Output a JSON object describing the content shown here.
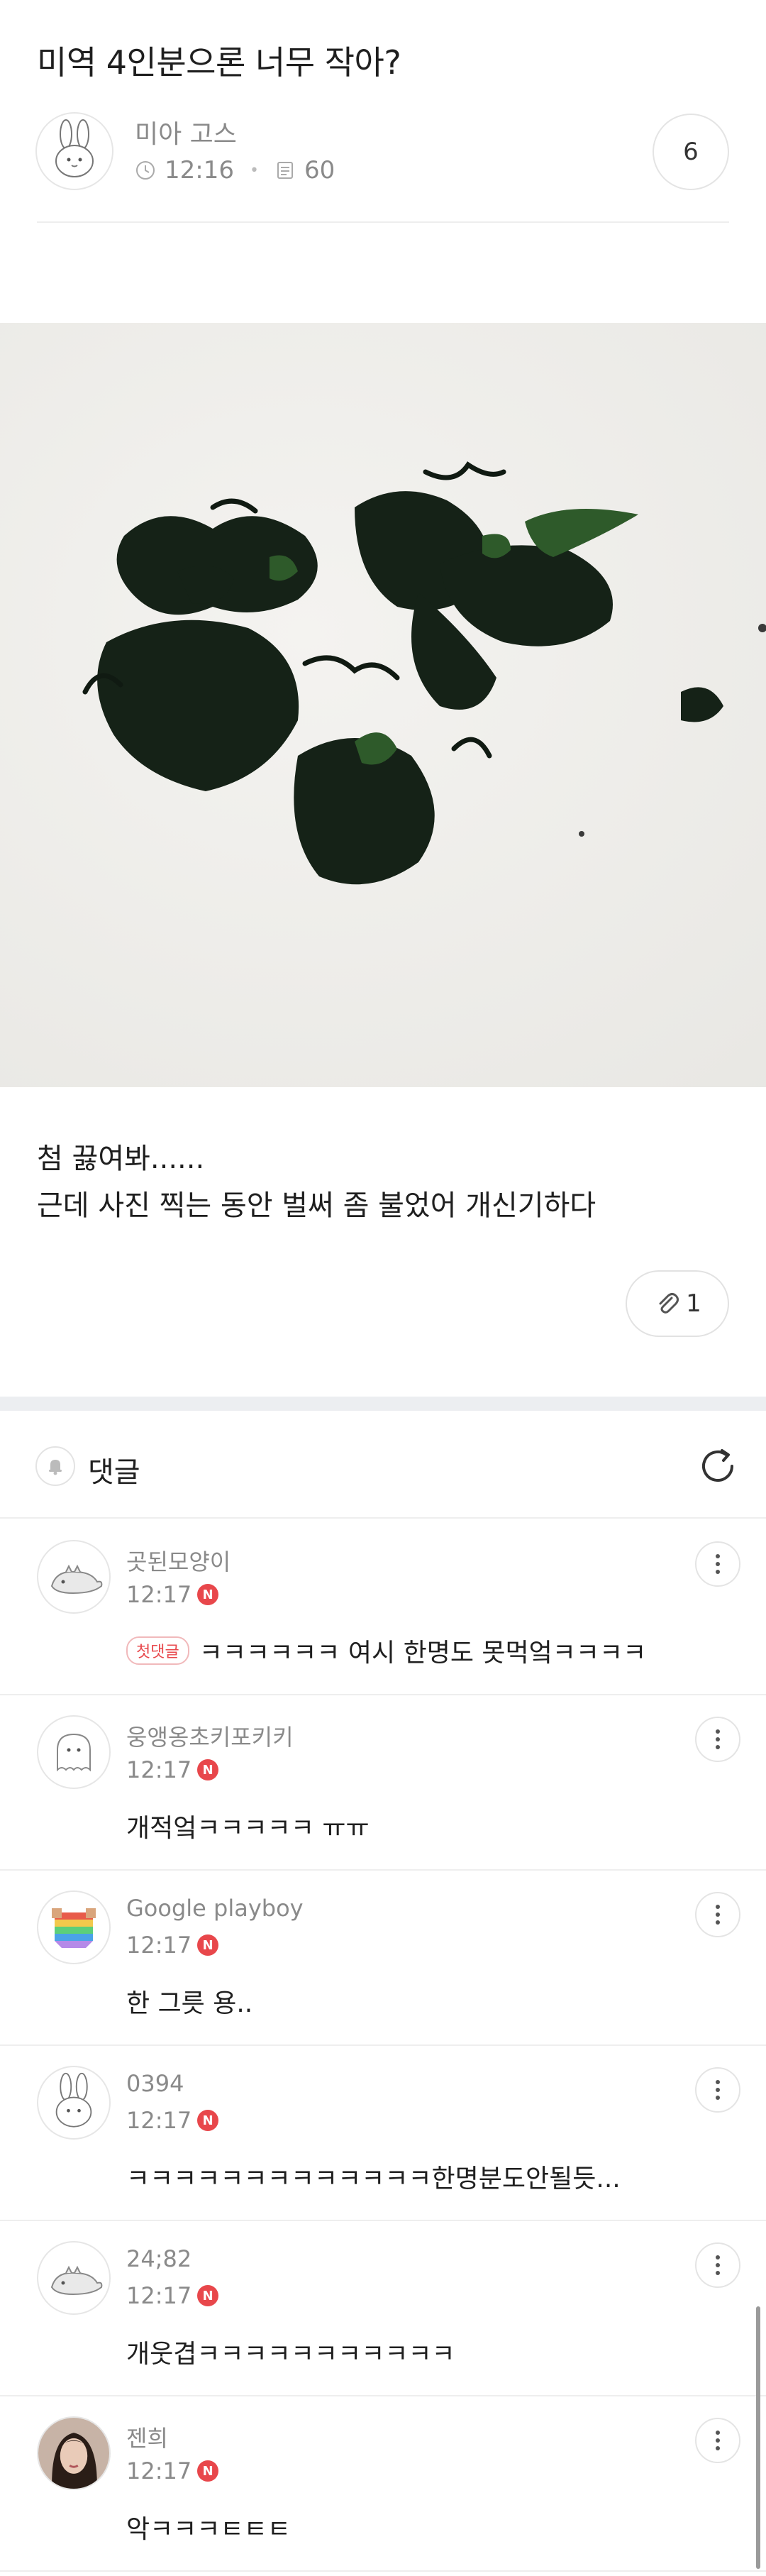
{
  "post": {
    "title": "미역 4인분으론 너무 작아?",
    "author": "미아 고스",
    "time": "12:16",
    "views": "60",
    "comment_count": "6",
    "body_lines": [
      "첨 끓여봐......",
      "근데 사진 찍는 동안 벌써 좀 불었어 개신기하다"
    ],
    "attachments": "1"
  },
  "comments_section": {
    "title": "댓글"
  },
  "comments": [
    {
      "name": "곳된모양이",
      "time": "12:17",
      "badge": "첫댓글",
      "text": "ㅋㅋㅋㅋㅋㅋ 여시 한명도 못먹엌ㅋㅋㅋㅋ",
      "avatar": "dino"
    },
    {
      "name": "웅앵옹초키포키키",
      "time": "12:17",
      "badge": "",
      "text": "개적엌ㅋㅋㅋㅋㅋ ㅠㅠ",
      "avatar": "ghost"
    },
    {
      "name": "Google playboy",
      "time": "12:17",
      "badge": "",
      "text": "한 그릇 용..",
      "avatar": "rainbow"
    },
    {
      "name": "0394",
      "time": "12:17",
      "badge": "",
      "text": "ㅋㅋㅋㅋㅋㅋㅋㅋㅋㅋㅋㅋㅋ한명분도안될듯...",
      "avatar": "bunny"
    },
    {
      "name": "24;82",
      "time": "12:17",
      "badge": "",
      "text": "개웃겹ㅋㅋㅋㅋㅋㅋㅋㅋㅋㅋㅋ",
      "avatar": "dino"
    },
    {
      "name": "젠희",
      "time": "12:17",
      "badge": "",
      "text": "악ㅋㅋㅋㅌㅌㅌ",
      "avatar": "photo"
    }
  ],
  "icons": {
    "new": "N"
  },
  "colors": {
    "accent_red": "#e8474b",
    "divider": "#eeeeee",
    "muted_text": "#8a8a8a"
  }
}
